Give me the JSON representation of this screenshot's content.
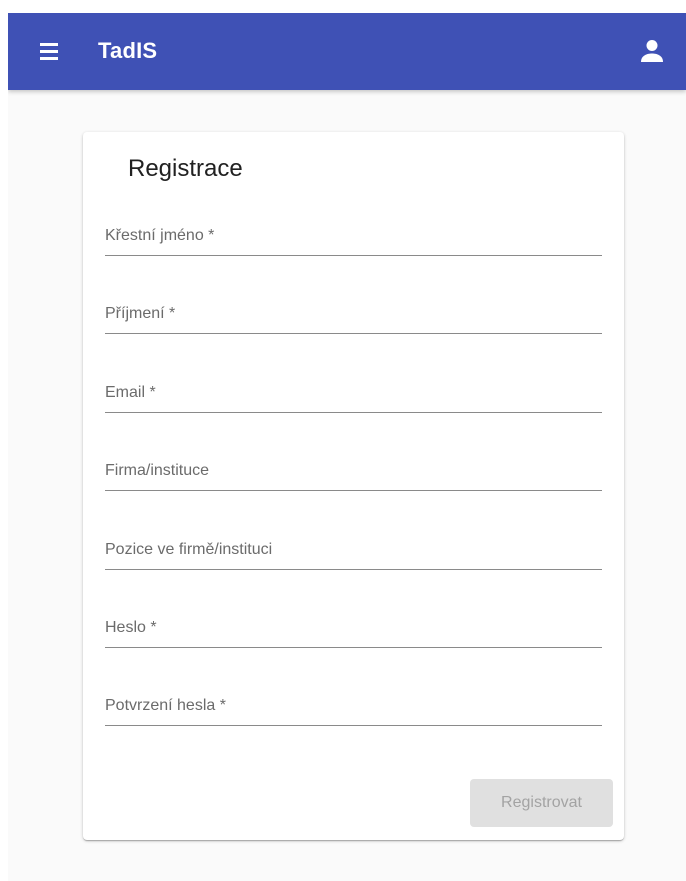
{
  "app": {
    "title": "TadIS",
    "menu_icon": "hamburger-menu-icon",
    "account_icon": "person-icon",
    "primary_color": "#3f51b5"
  },
  "form": {
    "title": "Registrace",
    "fields": [
      {
        "placeholder": "Křestní jméno *",
        "value": ""
      },
      {
        "placeholder": "Příjmení *",
        "value": ""
      },
      {
        "placeholder": "Email *",
        "value": ""
      },
      {
        "placeholder": "Firma/instituce",
        "value": ""
      },
      {
        "placeholder": "Pozice ve firmě/instituci",
        "value": ""
      },
      {
        "placeholder": "Heslo *",
        "value": ""
      },
      {
        "placeholder": "Potvrzení hesla *",
        "value": ""
      }
    ],
    "submit_label": "Registrovat",
    "submit_disabled": true
  }
}
